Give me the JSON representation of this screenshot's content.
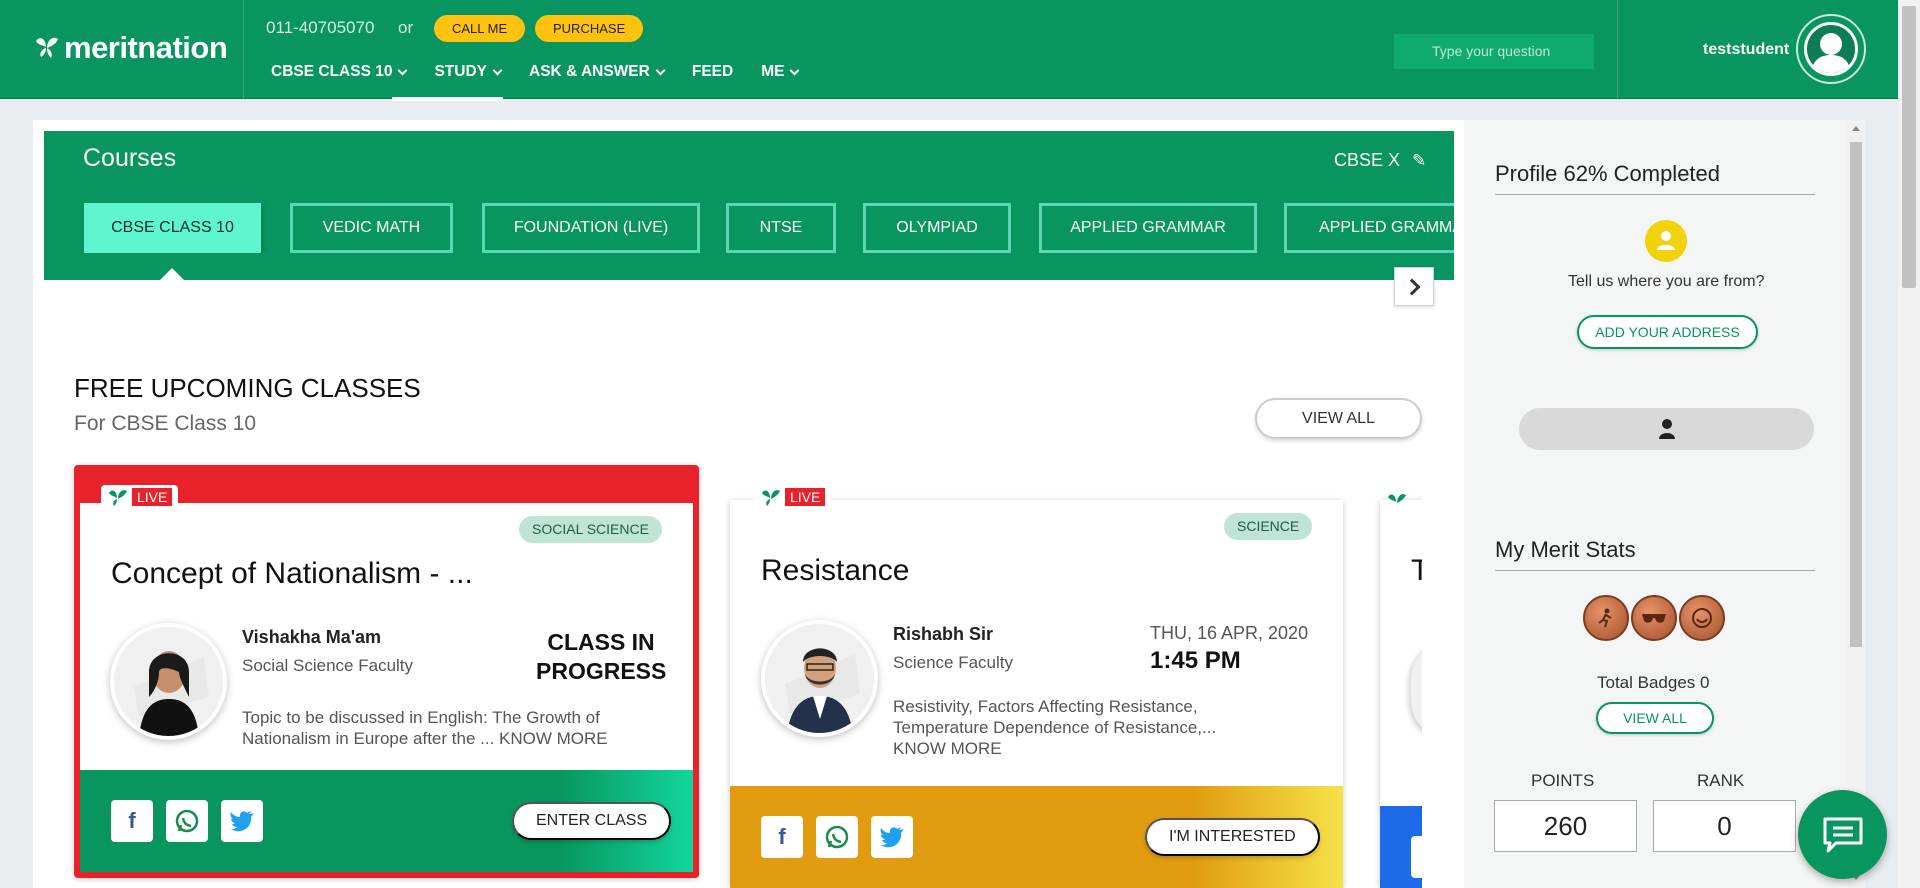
{
  "header": {
    "brand": "meritnation",
    "phone": "011-40705070",
    "or_text": "or",
    "call_me": "CALL ME",
    "purchase": "PURCHASE",
    "nav": [
      {
        "label": "CBSE CLASS 10"
      },
      {
        "label": "STUDY"
      },
      {
        "label": "ASK & ANSWER"
      },
      {
        "label": "FEED"
      },
      {
        "label": "ME"
      }
    ],
    "search_placeholder": "Type your question",
    "username": "teststudent",
    "colors": {
      "primary": "#08955f",
      "accent": "#ffc20e"
    }
  },
  "courses": {
    "title": "Courses",
    "board": "CBSE X",
    "tabs": [
      "CBSE CLASS 10",
      "VEDIC MATH",
      "FOUNDATION (LIVE)",
      "NTSE",
      "OLYMPIAD",
      "APPLIED GRAMMAR",
      "APPLIED GRAMMA"
    ],
    "active_tab": "CBSE CLASS 10"
  },
  "upcoming": {
    "title": "FREE UPCOMING CLASSES",
    "subtitle": "For CBSE Class 10",
    "view_all": "VIEW ALL",
    "cards": [
      {
        "live": "LIVE",
        "subject": "SOCIAL SCIENCE",
        "title": "Concept of Nationalism - ...",
        "teacher": "Vishakha Ma'am",
        "role": "Social Science Faculty",
        "status_line1": "CLASS IN",
        "status_line2": "PROGRESS",
        "topic_line1": "Topic to be discussed in English: The Growth of",
        "topic_line2": "Nationalism in Europe after the ... KNOW MORE",
        "action": "ENTER CLASS"
      },
      {
        "live": "LIVE",
        "subject": "SCIENCE",
        "title": "Resistance",
        "teacher": "Rishabh Sir",
        "role": "Science Faculty",
        "date": "THU, 16 APR, 2020",
        "time": "1:45 PM",
        "topic_line1": "Resistivity, Factors Affecting Resistance,",
        "topic_line2": "Temperature Dependence of Resistance,...",
        "topic_line3": "KNOW MORE",
        "action": "I'M INTERESTED"
      },
      {
        "title_partial": "T"
      }
    ]
  },
  "sidebar": {
    "profile_title": "Profile 62% Completed",
    "profile_percent": 62,
    "location_prompt": "Tell us where you are from?",
    "add_address": "ADD YOUR ADDRESS",
    "merit_title": "My Merit Stats",
    "total_badges": "Total Badges 0",
    "view_all": "VIEW ALL",
    "points_label": "POINTS",
    "points_value": "260",
    "rank_label": "RANK",
    "rank_value": "0"
  }
}
